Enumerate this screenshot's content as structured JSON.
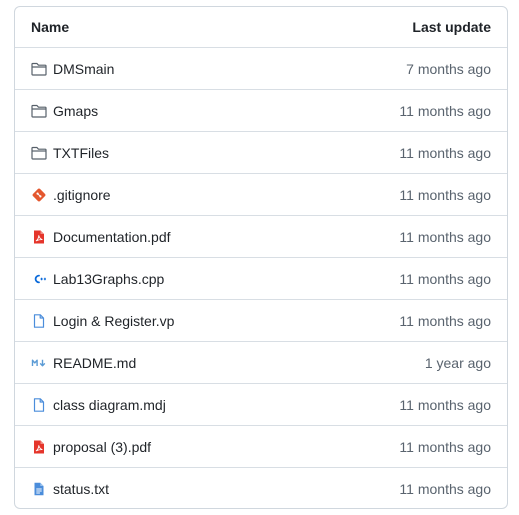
{
  "table": {
    "header": {
      "name_label": "Name",
      "date_label": "Last update"
    },
    "rows": [
      {
        "name": "DMSmain",
        "date": "7 months ago",
        "icon": "folder-icon"
      },
      {
        "name": "Gmaps",
        "date": "11 months ago",
        "icon": "folder-icon"
      },
      {
        "name": "TXTFiles",
        "date": "11 months ago",
        "icon": "folder-icon"
      },
      {
        "name": ".gitignore",
        "date": "11 months ago",
        "icon": "git-icon"
      },
      {
        "name": "Documentation.pdf",
        "date": "11 months ago",
        "icon": "pdf-icon"
      },
      {
        "name": "Lab13Graphs.cpp",
        "date": "11 months ago",
        "icon": "cpp-icon"
      },
      {
        "name": "Login & Register.vp",
        "date": "11 months ago",
        "icon": "file-icon"
      },
      {
        "name": "README.md",
        "date": "1 year ago",
        "icon": "markdown-icon"
      },
      {
        "name": "class diagram.mdj",
        "date": "11 months ago",
        "icon": "file-icon"
      },
      {
        "name": "proposal (3).pdf",
        "date": "11 months ago",
        "icon": "pdf-icon"
      },
      {
        "name": "status.txt",
        "date": "11 months ago",
        "icon": "text-file-icon"
      }
    ]
  },
  "colors": {
    "folder": "#57606a",
    "git": "#e4572e",
    "pdf": "#e5352b",
    "cpp": "#0969da",
    "file": "#4b8ddb",
    "markdown": "#5b9bd5",
    "text_file": "#4b8ddb"
  }
}
